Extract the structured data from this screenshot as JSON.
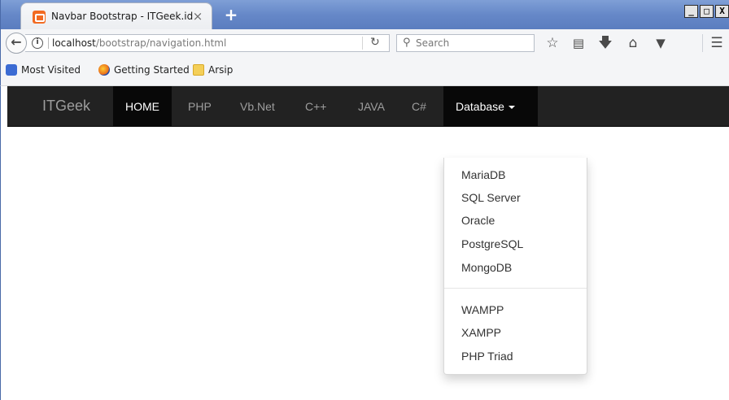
{
  "window": {
    "tab_title": "Navbar Bootstrap - ITGeek.id",
    "tab_close": "×",
    "new_tab": "+",
    "min": "_",
    "max": "□",
    "close": "X"
  },
  "toolbar": {
    "url_host": "localhost",
    "url_path": "/bootstrap/navigation.html",
    "search_placeholder": "Search"
  },
  "bookmarks": [
    {
      "label": "Most Visited"
    },
    {
      "label": "Getting Started"
    },
    {
      "label": "Arsip"
    }
  ],
  "site_nav": {
    "brand": "ITGeek",
    "items": [
      {
        "label": "HOME",
        "active": true
      },
      {
        "label": "PHP"
      },
      {
        "label": "Vb.Net"
      },
      {
        "label": "C++"
      },
      {
        "label": "JAVA"
      },
      {
        "label": "C#"
      },
      {
        "label": "Database",
        "dropdown_open": true
      }
    ]
  },
  "dropdown": {
    "group1": [
      "MariaDB",
      "SQL Server",
      "Oracle",
      "PostgreSQL",
      "MongoDB"
    ],
    "group2": [
      "WAMPP",
      "XAMPP",
      "PHP Triad"
    ]
  }
}
